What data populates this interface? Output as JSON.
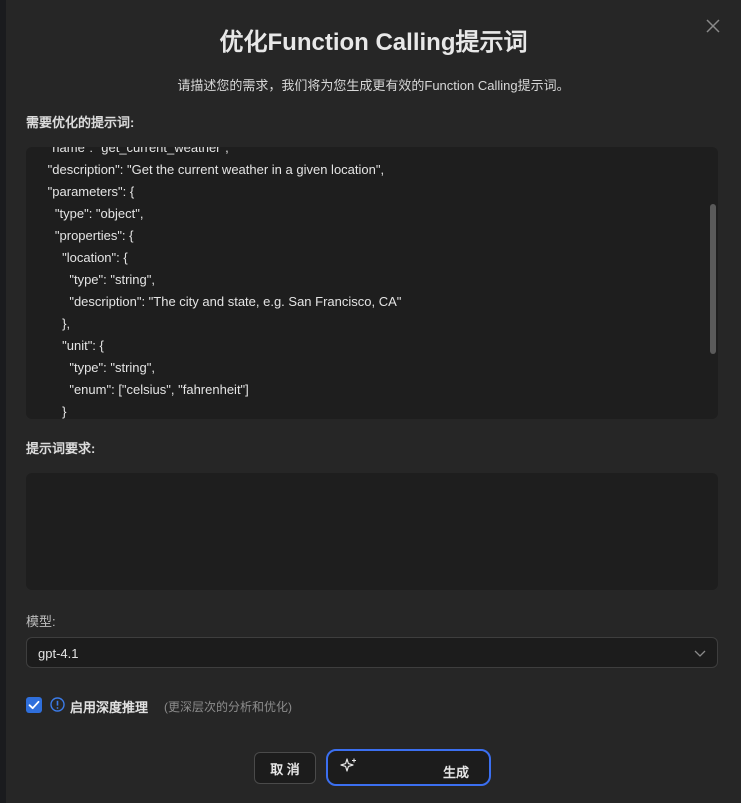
{
  "dialog": {
    "title": "优化Function Calling提示词",
    "subtitle": "请描述您的需求，我们将为您生成更有效的Function Calling提示词。"
  },
  "prompt_section": {
    "label": "需要优化的提示词:",
    "code_lines": [
      "      \"name\": \"get_current_weather\",",
      "      \"description\": \"Get the current weather in a given location\",",
      "      \"parameters\": {",
      "        \"type\": \"object\",",
      "        \"properties\": {",
      "          \"location\": {",
      "            \"type\": \"string\",",
      "            \"description\": \"The city and state, e.g. San Francisco, CA\"",
      "          },",
      "          \"unit\": {",
      "            \"type\": \"string\",",
      "            \"enum\": [\"celsius\", \"fahrenheit\"]",
      "          }"
    ]
  },
  "requirements_section": {
    "label": "提示词要求:",
    "value": ""
  },
  "model_section": {
    "label": "模型:",
    "selected": "gpt-4.1"
  },
  "deep_reasoning": {
    "checked": true,
    "label": "启用深度推理",
    "hint": "(更深层次的分析和优化)"
  },
  "buttons": {
    "cancel": "取 消",
    "generate": "生成"
  },
  "colors": {
    "accent": "#3b6ff0",
    "checkbox": "#2f6fdc",
    "modal_bg": "#262626",
    "field_bg": "#1e1e1e"
  },
  "icons": {
    "close": "close-icon",
    "chevron": "chevron-down-icon",
    "check": "check-icon",
    "info": "info-icon",
    "sparkle": "sparkle-icon"
  }
}
